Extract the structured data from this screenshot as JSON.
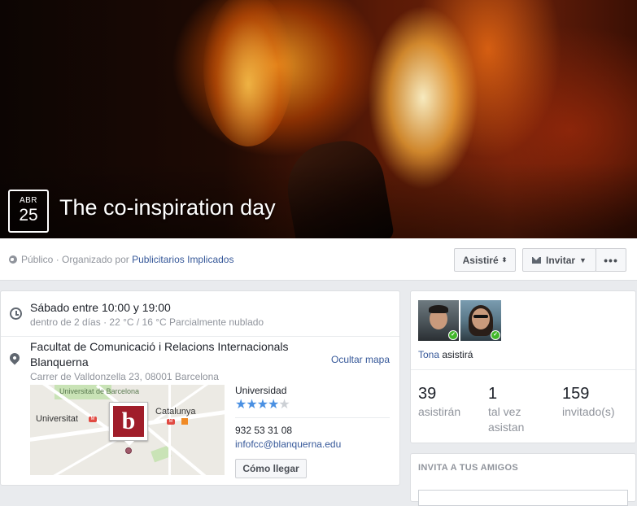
{
  "event": {
    "month": "ABR",
    "day": "25",
    "title": "The co-inspiration day"
  },
  "info_bar": {
    "privacy": "Público",
    "organized_by": " · Organizado por ",
    "organizer": "Publicitarios Implicados",
    "going_button": "Asistiré",
    "invite_button": "Invitar",
    "icons": [
      "globe-icon",
      "sort-icon",
      "mail-icon",
      "caret-down-icon",
      "more-icon"
    ]
  },
  "details": {
    "time_main": "Sábado entre 10:00 y 19:00",
    "time_sub": "dentro de 2 días · 22 °C / 16 °C Parcialmente nublado",
    "place_name": "Facultat de Comunicació i Relacions Internacionals Blanquerna",
    "hide_map": "Ocultar mapa",
    "address": "Carrer de Valldonzella 23, 08001 Barcelona",
    "map": {
      "label_university": "Universitat",
      "label_catalunya": "Catalunya",
      "label_park": "Universitat de Barcelona",
      "metro": "M",
      "logo_letter": "b"
    },
    "place_type": "Universidad",
    "rating_stars": 4,
    "rating_max": 5,
    "phone": "932 53 31 08",
    "email": "infofcc@blanquerna.edu",
    "directions_button": "Cómo llegar"
  },
  "guests": {
    "friend_name": "Tona",
    "friend_status": " asistirá",
    "stats": [
      {
        "number": "39",
        "label": "asistirán"
      },
      {
        "number": "1",
        "label": "tal vez asistan"
      },
      {
        "number": "159",
        "label": "invitado(s)"
      }
    ]
  },
  "invite": {
    "title": "INVITA A TUS AMIGOS"
  },
  "colors": {
    "link": "#365899",
    "muted": "#90949c",
    "star": "#4a90e2",
    "check": "#42b72a",
    "logo": "#a01d2a"
  }
}
